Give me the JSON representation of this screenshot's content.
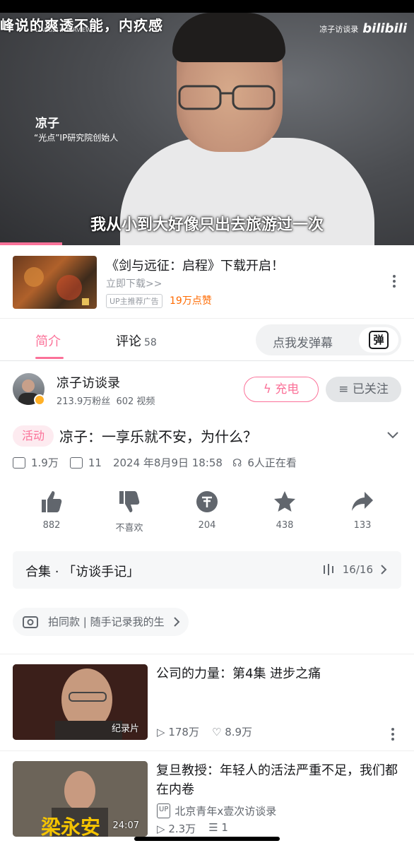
{
  "video": {
    "subtitle_top": "峰说的爽透不能，内疚感",
    "logo_text": "LIANGZI INTERVIEW",
    "brand_name": "凉子访谈录",
    "brand_logo": "bilibili",
    "speaker_name": "凉子",
    "speaker_role": "“光点”IP研究院创始人",
    "subtitle": "我从小到大好像只出去旅游过一次",
    "progress_fraction": 0.15
  },
  "ad": {
    "title": "《剑与远征：启程》下载开启！",
    "cta": "立即下载>>",
    "tag": "UP主推荐广告",
    "likes": "19万点赞",
    "menu_icon": "more-vertical-icon"
  },
  "tabs": {
    "intro": "简介",
    "comments": "评论",
    "comment_count": "58",
    "danmaku_placeholder": "点我发弹幕",
    "danmaku_icon_text": "弹"
  },
  "uploader": {
    "name": "凉子访谈录",
    "fans": "213.9万粉丝",
    "videos": "602 视频",
    "charge_label": "充电",
    "follow_label": "已关注"
  },
  "title": {
    "tag": "活动",
    "text": "凉子：一享乐就不安，为什么？"
  },
  "meta": {
    "plays": "1.9万",
    "danmaku": "11",
    "date": "2024 年8月9日  18:58",
    "watching": "6人正在看"
  },
  "actions": [
    {
      "icon": "thumbs-up-icon",
      "label": "882"
    },
    {
      "icon": "thumbs-down-icon",
      "label": "不喜欢"
    },
    {
      "icon": "coin-icon",
      "label": "204"
    },
    {
      "icon": "star-icon",
      "label": "438"
    },
    {
      "icon": "share-icon",
      "label": "133"
    }
  ],
  "collection": {
    "name": "合集 · 「访谈手记」",
    "count": "16/16"
  },
  "same_style": "拍同款 | 随手记录我的生",
  "recs": [
    {
      "title": "公司的力量：第4集  进步之痛",
      "badge": "纪录片",
      "plays": "178万",
      "likes": "8.9万"
    },
    {
      "title": "复旦教授：年轻人的活法严重不足，我们都在内卷",
      "badge": "24:07",
      "thumb_text": "梁永安",
      "up_name": "北京青年x壹次访谈录",
      "plays": "2.3万",
      "danmaku": "1"
    }
  ],
  "colors": {
    "accent": "#fb7299",
    "ad_likes": "#ff6a00",
    "secondary_text": "#61666d"
  }
}
